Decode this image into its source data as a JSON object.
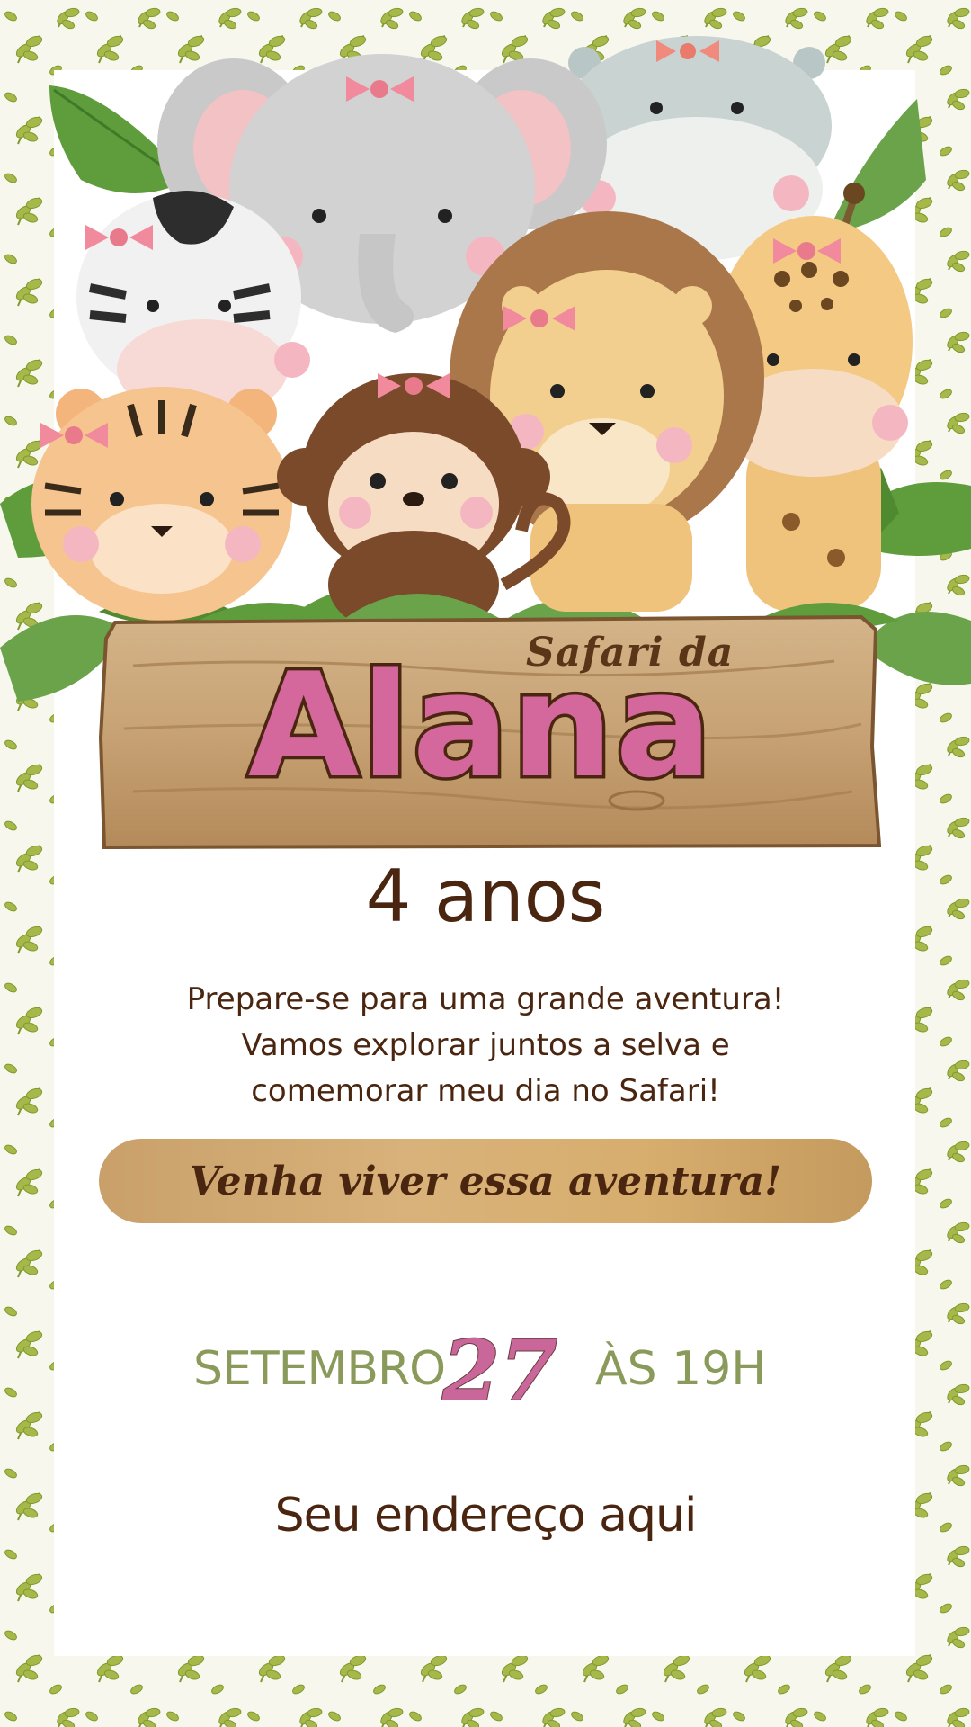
{
  "invite": {
    "subtitle": "Safari da",
    "name": "Alana",
    "age": "4 anos",
    "message": [
      "Prepare-se para uma grande aventura!",
      "Vamos explorar juntos a selva e",
      "comemorar meu dia no Safari!"
    ],
    "banner": "Venha viver essa aventura!",
    "month": "SETEMBRO",
    "day": "27",
    "time": "ÀS 19H",
    "address": "Seu endereço aqui"
  },
  "colors": {
    "name_pink": "#d4679c",
    "brown_text": "#4a2510",
    "olive_green": "#8a9a5b",
    "banner_gold": "#d8b27a",
    "leaf_green": "#a6b84a"
  },
  "illustration": {
    "animals": [
      "elephant-icon",
      "hippo-icon",
      "zebra-icon",
      "lion-icon",
      "giraffe-icon",
      "monkey-icon",
      "tiger-icon"
    ]
  }
}
